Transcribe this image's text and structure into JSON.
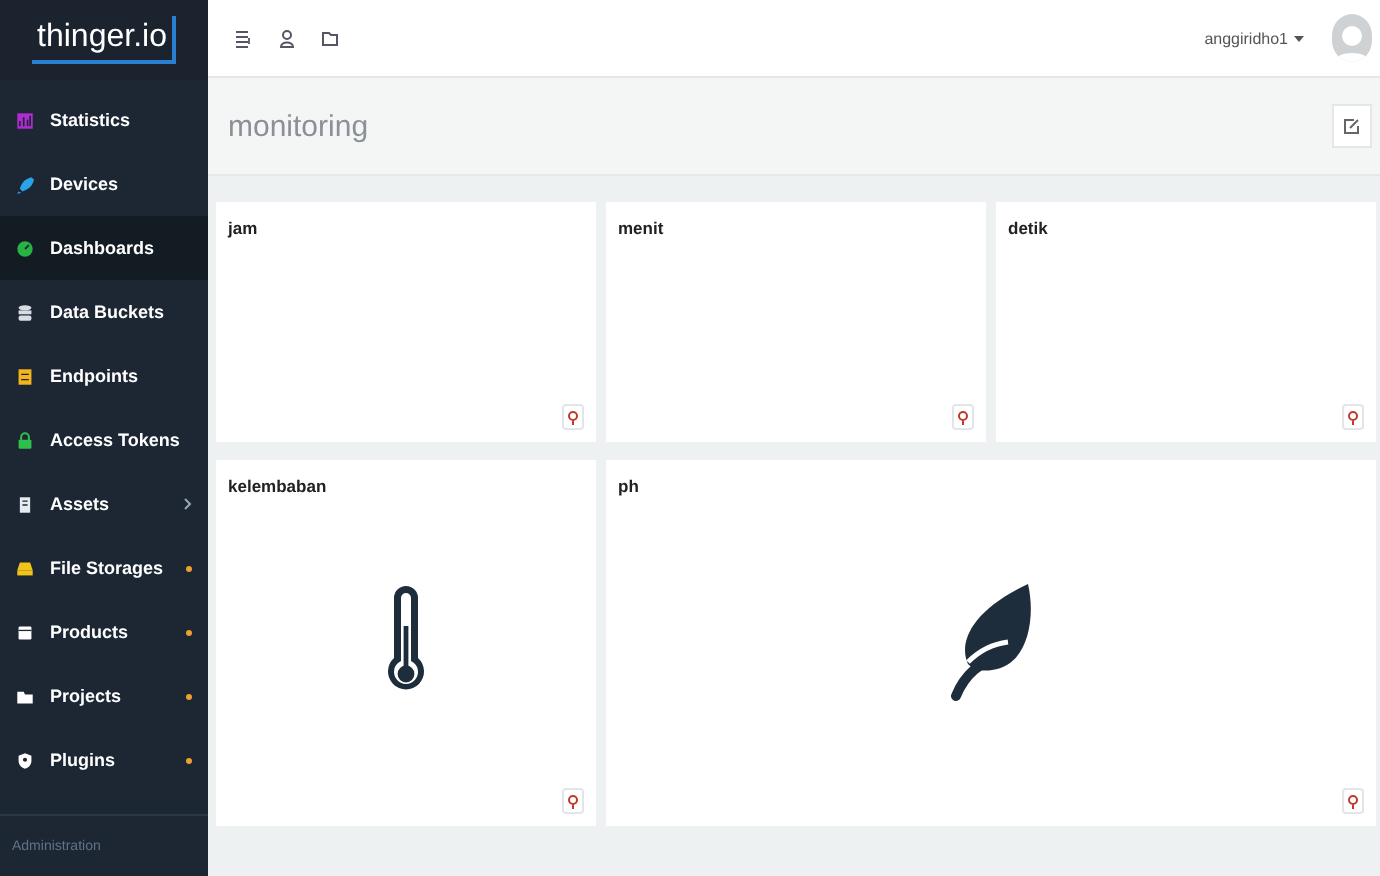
{
  "logo": {
    "text": "thinger.io"
  },
  "sidebar": {
    "items": [
      {
        "label": "Statistics",
        "color": "#b02bd0",
        "selected": false,
        "kind": "plain"
      },
      {
        "label": "Devices",
        "color": "#2aa3e8",
        "selected": false,
        "kind": "plain"
      },
      {
        "label": "Dashboards",
        "color": "#27b244",
        "selected": true,
        "kind": "plain"
      },
      {
        "label": "Data Buckets",
        "color": "#d6dde3",
        "selected": false,
        "kind": "plain"
      },
      {
        "label": "Endpoints",
        "color": "#f2b51c",
        "selected": false,
        "kind": "plain"
      },
      {
        "label": "Access Tokens",
        "color": "#2fbf4a",
        "selected": false,
        "kind": "plain"
      },
      {
        "label": "Assets",
        "color": "#e6ebef",
        "selected": false,
        "kind": "submenu"
      },
      {
        "label": "File Storages",
        "color": "#f0c419",
        "selected": false,
        "kind": "badge"
      },
      {
        "label": "Products",
        "color": "#ffffff",
        "selected": false,
        "kind": "badge"
      },
      {
        "label": "Projects",
        "color": "#ffffff",
        "selected": false,
        "kind": "badge"
      },
      {
        "label": "Plugins",
        "color": "#ffffff",
        "selected": false,
        "kind": "badge"
      }
    ],
    "section": "Administration"
  },
  "topbar": {
    "user": "anggiridho1"
  },
  "dashboard": {
    "title": "monitoring",
    "rows": [
      [
        {
          "title": "jam",
          "kind": "empty"
        },
        {
          "title": "menit",
          "kind": "empty"
        },
        {
          "title": "detik",
          "kind": "empty"
        }
      ],
      [
        {
          "title": "kelembaban",
          "kind": "thermometer"
        },
        {
          "title": "ph",
          "kind": "leaf"
        }
      ]
    ]
  }
}
